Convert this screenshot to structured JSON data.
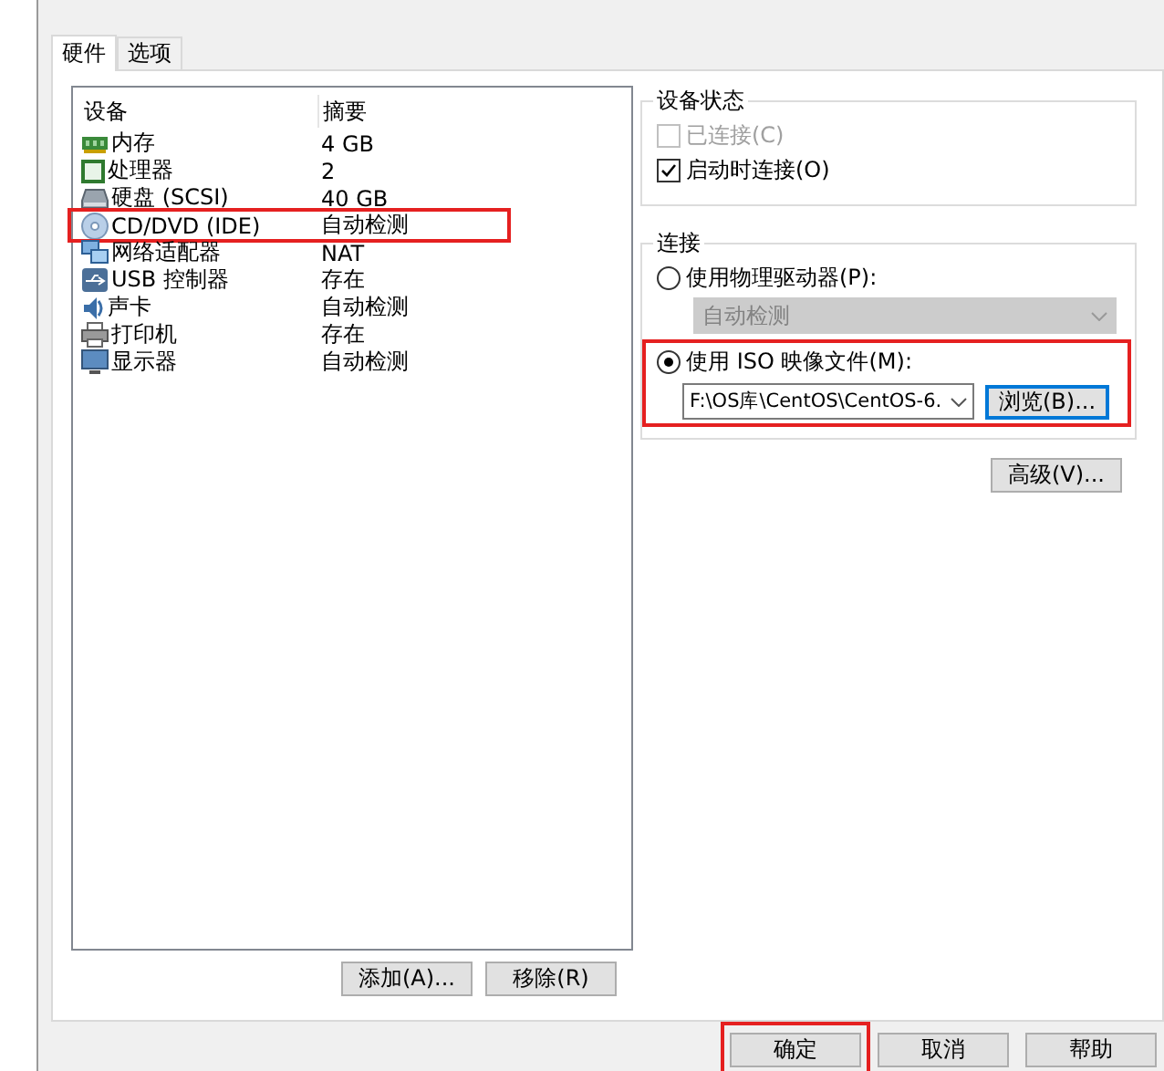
{
  "tabs": [
    {
      "label": "硬件",
      "selected": true
    },
    {
      "label": "选项",
      "selected": false
    }
  ],
  "device_list": {
    "columns": [
      "设备",
      "摘要"
    ],
    "rows": [
      {
        "kind": "memory",
        "device": "内存",
        "summary": "4 GB",
        "annotated": false
      },
      {
        "kind": "cpu",
        "device": "处理器",
        "summary": "2",
        "annotated": false
      },
      {
        "kind": "disk",
        "device": "硬盘 (SCSI)",
        "summary": "40 GB",
        "annotated": false
      },
      {
        "kind": "cd",
        "device": "CD/DVD (IDE)",
        "summary": "自动检测",
        "annotated": true
      },
      {
        "kind": "network",
        "device": "网络适配器",
        "summary": "NAT",
        "annotated": false
      },
      {
        "kind": "usb",
        "device": "USB 控制器",
        "summary": "存在",
        "annotated": false
      },
      {
        "kind": "sound",
        "device": "声卡",
        "summary": "自动检测",
        "annotated": false
      },
      {
        "kind": "printer",
        "device": "打印机",
        "summary": "存在",
        "annotated": false
      },
      {
        "kind": "display",
        "device": "显示器",
        "summary": "自动检测",
        "annotated": false
      }
    ]
  },
  "list_buttons": [
    "添加(A)...",
    "移除(R)"
  ],
  "device_status": {
    "title": "设备状态",
    "options": [
      {
        "label": "已连接(C)",
        "checked": false,
        "disabled": true
      },
      {
        "label": "启动时连接(O)",
        "checked": true,
        "disabled": false
      }
    ]
  },
  "connection": {
    "title": "连接",
    "physical": {
      "label": "使用物理驱动器(P):",
      "selected": false,
      "drive": {
        "value": "自动检测",
        "disabled": true
      }
    },
    "iso": {
      "label": "使用 ISO 映像文件(M):",
      "selected": true,
      "path": "F:\\OS库\\CentOS\\CentOS-6.",
      "browse": "浏览(B)...",
      "annotated": true
    }
  },
  "advanced_button": "高级(V)...",
  "dialog_buttons": [
    {
      "label": "确定",
      "annotated": true
    },
    {
      "label": "取消",
      "annotated": false
    },
    {
      "label": "帮助",
      "annotated": false
    }
  ]
}
